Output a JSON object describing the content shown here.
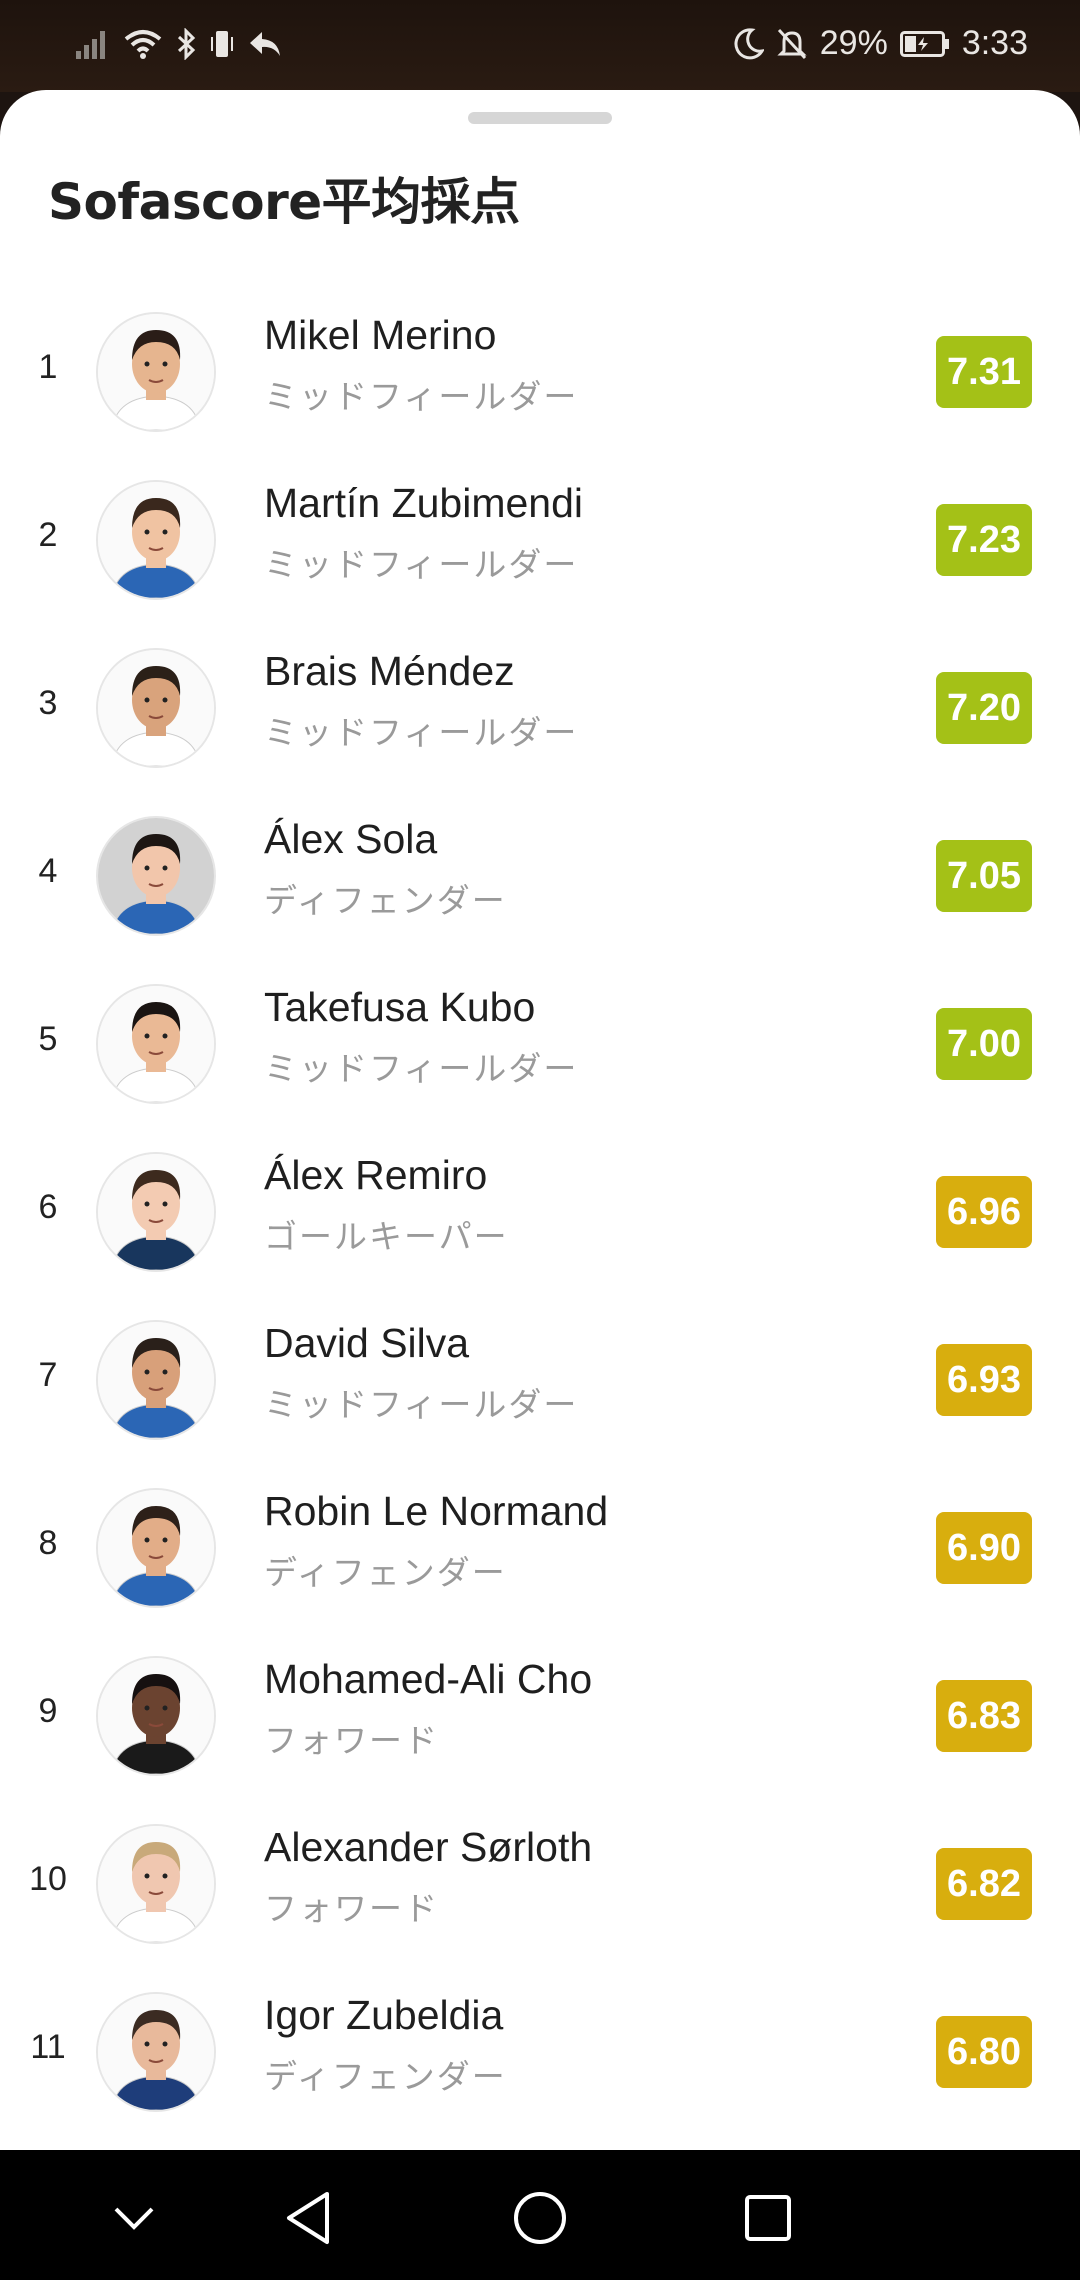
{
  "status_bar": {
    "battery": "29%",
    "time": "3:33",
    "icons_left": [
      "signal-icon",
      "wifi-icon",
      "bluetooth-icon",
      "vibrate-icon",
      "reply-icon"
    ],
    "icons_right": [
      "moon-icon",
      "bell-off-icon",
      "battery-icon"
    ]
  },
  "sheet": {
    "title": "Sofascore平均採点"
  },
  "players": [
    {
      "rank": "1",
      "name": "Mikel Merino",
      "position": "ミッドフィールダー",
      "rating": "7.31",
      "rating_color": "#a4c117"
    },
    {
      "rank": "2",
      "name": "Martín Zubimendi",
      "position": "ミッドフィールダー",
      "rating": "7.23",
      "rating_color": "#a4c117"
    },
    {
      "rank": "3",
      "name": "Brais Méndez",
      "position": "ミッドフィールダー",
      "rating": "7.20",
      "rating_color": "#a4c117"
    },
    {
      "rank": "4",
      "name": "Álex Sola",
      "position": "ディフェンダー",
      "rating": "7.05",
      "rating_color": "#a4c117"
    },
    {
      "rank": "5",
      "name": "Takefusa Kubo",
      "position": "ミッドフィールダー",
      "rating": "7.00",
      "rating_color": "#a4c117"
    },
    {
      "rank": "6",
      "name": "Álex Remiro",
      "position": "ゴールキーパー",
      "rating": "6.96",
      "rating_color": "#d8ae0e"
    },
    {
      "rank": "7",
      "name": "David Silva",
      "position": "ミッドフィールダー",
      "rating": "6.93",
      "rating_color": "#d8ae0e"
    },
    {
      "rank": "8",
      "name": "Robin Le Normand",
      "position": "ディフェンダー",
      "rating": "6.90",
      "rating_color": "#d8ae0e"
    },
    {
      "rank": "9",
      "name": "Mohamed-Ali Cho",
      "position": "フォワード",
      "rating": "6.83",
      "rating_color": "#d8ae0e"
    },
    {
      "rank": "10",
      "name": "Alexander Sørloth",
      "position": "フォワード",
      "rating": "6.82",
      "rating_color": "#d8ae0e"
    },
    {
      "rank": "11",
      "name": "Igor Zubeldia",
      "position": "ディフェンダー",
      "rating": "6.80",
      "rating_color": "#d8ae0e"
    }
  ],
  "nav_bar": {
    "buttons": [
      "collapse-icon",
      "back-icon",
      "home-icon",
      "recents-icon"
    ]
  }
}
